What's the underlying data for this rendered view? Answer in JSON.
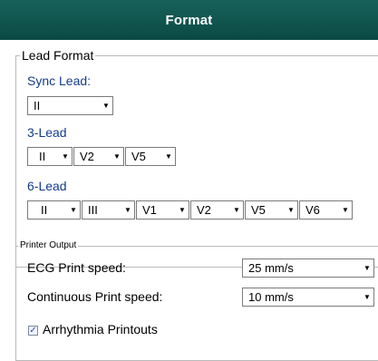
{
  "window": {
    "title": "Format"
  },
  "lead_format": {
    "group_label": "Lead Format",
    "sync_lead": {
      "label": "Sync Lead:",
      "value": "II"
    },
    "three_lead": {
      "label": "3-Lead",
      "values": [
        "II",
        "V2",
        "V5"
      ]
    },
    "six_lead": {
      "label": "6-Lead",
      "values": [
        "II",
        "III",
        "V1",
        "V2",
        "V5",
        "V6"
      ]
    }
  },
  "printer_output": {
    "group_label": "Printer Output",
    "ecg_print_speed": {
      "label": "ECG Print speed:",
      "value": "25 mm/s"
    },
    "continuous_print_speed": {
      "label": "Continuous Print speed:",
      "value": "10 mm/s"
    },
    "arrhythmia_printouts": {
      "label": "Arrhythmia Printouts",
      "checked": true,
      "check_glyph": "✓"
    }
  },
  "icons": {
    "dropdown_arrow": "▼"
  }
}
